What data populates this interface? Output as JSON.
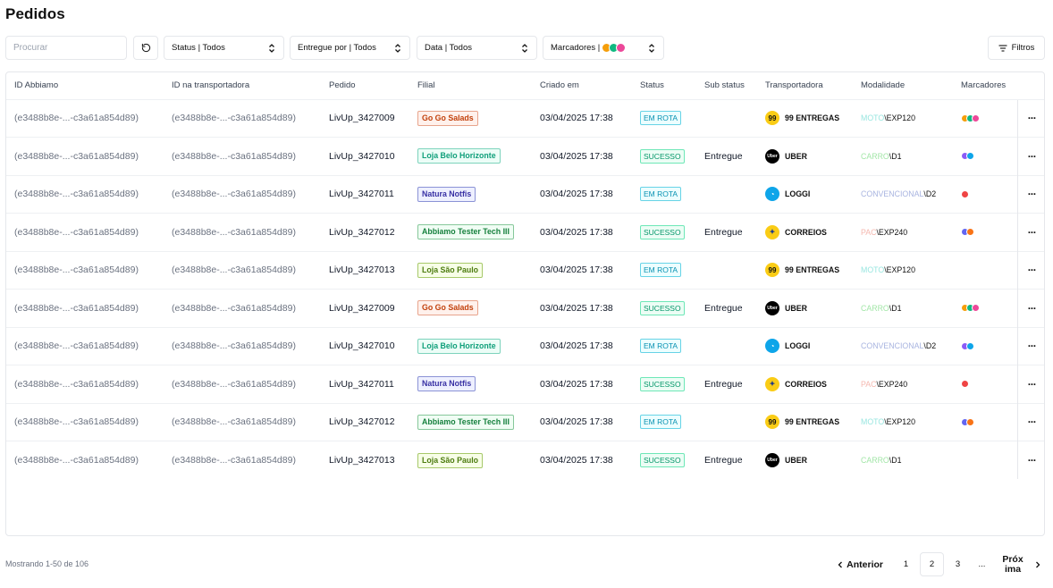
{
  "page": {
    "title": "Pedidos"
  },
  "toolbar": {
    "search_placeholder": "Procurar",
    "status_filter": "Status | Todos",
    "delivered_by_filter": "Entregue por | Todos",
    "date_filter": "Data | Todos",
    "markers_filter": "Marcadores |",
    "filters_label": "Filtros"
  },
  "table": {
    "headers": [
      "ID Abbiamo",
      "ID na transportadora",
      "Pedido",
      "Filial",
      "Criado em",
      "Status",
      "Sub status",
      "Transportadora",
      "Modalidade",
      "Marcadores"
    ],
    "rows": [
      {
        "id": "(e3488b8e-...-c3a61a854d89)",
        "carrier_id": "(e3488b8e-...-c3a61a854d89)",
        "order": "LivUp_3427009",
        "branch": "Go Go Salads",
        "created": "03/04/2025 17:38",
        "status": "EM ROTA",
        "sub_status": "",
        "carrier": "99 ENTREGAS",
        "modal_kind": "MOTO",
        "modal_code": "\\EXP120",
        "markers": [
          "#f59e0b",
          "#10b981",
          "#ec4899"
        ]
      },
      {
        "id": "(e3488b8e-...-c3a61a854d89)",
        "carrier_id": "(e3488b8e-...-c3a61a854d89)",
        "order": "LivUp_3427010",
        "branch": "Loja Belo Horizonte",
        "created": "03/04/2025 17:38",
        "status": "SUCESSO",
        "sub_status": "Entregue",
        "carrier": "UBER",
        "modal_kind": "CARRO",
        "modal_code": "\\D1",
        "markers": [
          "#8b5cf6",
          "#0ea5e9"
        ]
      },
      {
        "id": "(e3488b8e-...-c3a61a854d89)",
        "carrier_id": "(e3488b8e-...-c3a61a854d89)",
        "order": "LivUp_3427011",
        "branch": "Natura Notfis",
        "created": "03/04/2025 17:38",
        "status": "EM ROTA",
        "sub_status": "",
        "carrier": "LOGGI",
        "modal_kind": "CONVENCIONAL",
        "modal_code": "\\D2",
        "markers": [
          "#ef4444"
        ]
      },
      {
        "id": "(e3488b8e-...-c3a61a854d89)",
        "carrier_id": "(e3488b8e-...-c3a61a854d89)",
        "order": "LivUp_3427012",
        "branch": "Abbiamo Tester Tech III",
        "created": "03/04/2025 17:38",
        "status": "SUCESSO",
        "sub_status": "Entregue",
        "carrier": "CORREIOS",
        "modal_kind": "PAC",
        "modal_code": "\\EXP240",
        "markers": [
          "#6366f1",
          "#f97316"
        ]
      },
      {
        "id": "(e3488b8e-...-c3a61a854d89)",
        "carrier_id": "(e3488b8e-...-c3a61a854d89)",
        "order": "LivUp_3427013",
        "branch": "Loja São Paulo",
        "created": "03/04/2025 17:38",
        "status": "EM ROTA",
        "sub_status": "",
        "carrier": "99 ENTREGAS",
        "modal_kind": "MOTO",
        "modal_code": "\\EXP120",
        "markers": []
      },
      {
        "id": "(e3488b8e-...-c3a61a854d89)",
        "carrier_id": "(e3488b8e-...-c3a61a854d89)",
        "order": "LivUp_3427009",
        "branch": "Go Go Salads",
        "created": "03/04/2025 17:38",
        "status": "SUCESSO",
        "sub_status": "Entregue",
        "carrier": "UBER",
        "modal_kind": "CARRO",
        "modal_code": "\\D1",
        "markers": [
          "#f59e0b",
          "#10b981",
          "#ec4899"
        ]
      },
      {
        "id": "(e3488b8e-...-c3a61a854d89)",
        "carrier_id": "(e3488b8e-...-c3a61a854d89)",
        "order": "LivUp_3427010",
        "branch": "Loja Belo Horizonte",
        "created": "03/04/2025 17:38",
        "status": "EM ROTA",
        "sub_status": "",
        "carrier": "LOGGI",
        "modal_kind": "CONVENCIONAL",
        "modal_code": "\\D2",
        "markers": [
          "#8b5cf6",
          "#0ea5e9"
        ]
      },
      {
        "id": "(e3488b8e-...-c3a61a854d89)",
        "carrier_id": "(e3488b8e-...-c3a61a854d89)",
        "order": "LivUp_3427011",
        "branch": "Natura Notfis",
        "created": "03/04/2025 17:38",
        "status": "SUCESSO",
        "sub_status": "Entregue",
        "carrier": "CORREIOS",
        "modal_kind": "PAC",
        "modal_code": "\\EXP240",
        "markers": [
          "#ef4444"
        ]
      },
      {
        "id": "(e3488b8e-...-c3a61a854d89)",
        "carrier_id": "(e3488b8e-...-c3a61a854d89)",
        "order": "LivUp_3427012",
        "branch": "Abbiamo Tester Tech III",
        "created": "03/04/2025 17:38",
        "status": "EM ROTA",
        "sub_status": "",
        "carrier": "99 ENTREGAS",
        "modal_kind": "MOTO",
        "modal_code": "\\EXP120",
        "markers": [
          "#6366f1",
          "#f97316"
        ]
      },
      {
        "id": "(e3488b8e-...-c3a61a854d89)",
        "carrier_id": "(e3488b8e-...-c3a61a854d89)",
        "order": "LivUp_3427013",
        "branch": "Loja São Paulo",
        "created": "03/04/2025 17:38",
        "status": "SUCESSO",
        "sub_status": "Entregue",
        "carrier": "UBER",
        "modal_kind": "CARRO",
        "modal_code": "\\D1",
        "markers": []
      }
    ]
  },
  "branch_styles": {
    "Go Go Salads": {
      "color": "#c2410c",
      "bg": "#fff1ec",
      "border": "#e8a48c"
    },
    "Loja Belo Horizonte": {
      "color": "#0f9f7a",
      "bg": "#ecfdf7",
      "border": "#7dd3bc"
    },
    "Natura Notfis": {
      "color": "#3730a3",
      "bg": "#eef0ff",
      "border": "#8b93d6"
    },
    "Abbiamo Tester Tech III": {
      "color": "#15803d",
      "bg": "#f0fdf4",
      "border": "#86c79a"
    },
    "Loja São Paulo": {
      "color": "#4d7c0f",
      "bg": "#f7fee7",
      "border": "#a7c96a"
    }
  },
  "status_styles": {
    "EM ROTA": {
      "color": "#0891b2",
      "bg": "#ecfeff",
      "border": "#67d3e6"
    },
    "SUCESSO": {
      "color": "#059669",
      "bg": "#ecfdf5",
      "border": "#6ee7b7"
    }
  },
  "carrier_styles": {
    "99 ENTREGAS": {
      "logo": "99",
      "bg": "#facc15",
      "fg": "#111111"
    },
    "UBER": {
      "logo": "Uber",
      "bg": "#000000",
      "fg": "#ffffff"
    },
    "LOGGI": {
      "logo": "◔",
      "bg": "#0ea5e9",
      "fg": "#ffffff"
    },
    "CORREIOS": {
      "logo": "✦",
      "bg": "#facc15",
      "fg": "#1e3a8a"
    }
  },
  "modal_colors": {
    "MOTO": "#99e6e0",
    "CARRO": "#a3e6a8",
    "CONVENCIONAL": "#a8b4e0",
    "PAC": "#f5b8b0"
  },
  "marker_filter_colors": [
    "#f59e0b",
    "#10b981",
    "#ec4899"
  ],
  "footer": {
    "showing": "Mostrando 1-50 de 106"
  },
  "pagination": {
    "previous": "Anterior",
    "pages": [
      "1",
      "2",
      "3",
      "..."
    ],
    "current": "2",
    "next": "Próx ima"
  }
}
